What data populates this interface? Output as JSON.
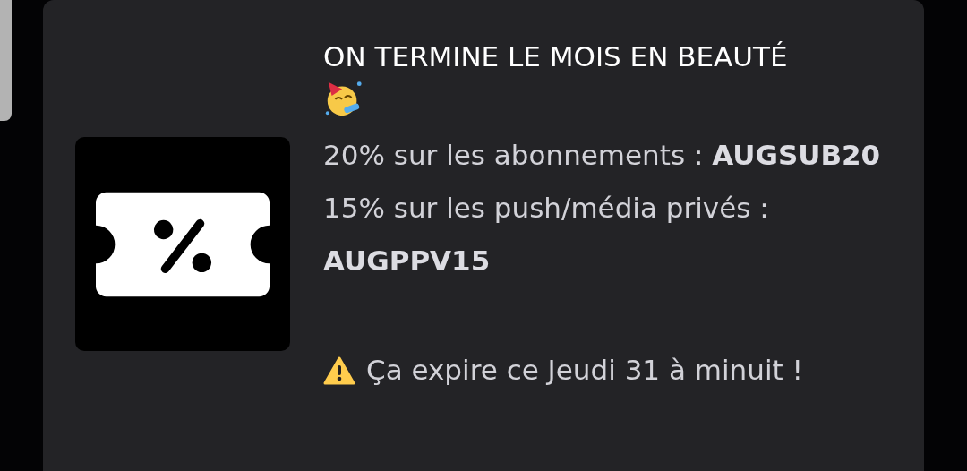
{
  "promo": {
    "title": "ON TERMINE LE MOIS EN BEAUTÉ",
    "offers": [
      "20% sur les abonnements : **AUGSUB20**",
      "15% sur les push/média privés : **AUGPPV15**"
    ],
    "warning": "Ça expire ce Jeudi 31 à minuit !"
  }
}
